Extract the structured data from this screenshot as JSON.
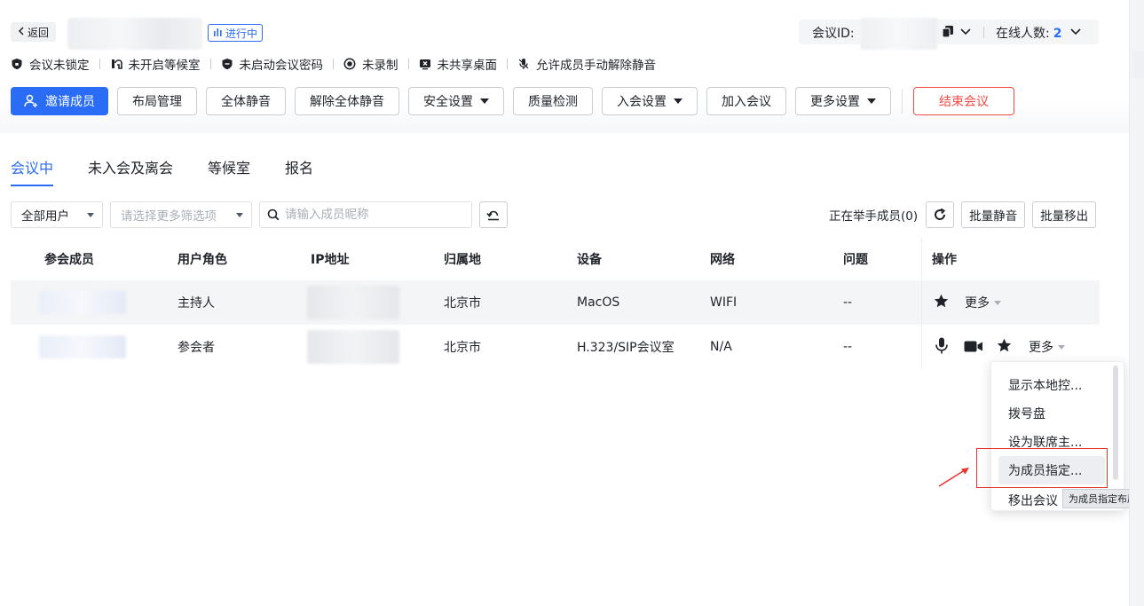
{
  "header": {
    "back_label": "返回",
    "status_tag": "进行中",
    "meeting_id_label": "会议ID:",
    "online_label": "在线人数:",
    "online_count": "2"
  },
  "status_items": [
    {
      "icon": "shield-icon",
      "label": "会议未锁定"
    },
    {
      "icon": "waiting-room-icon",
      "label": "未开启等候室"
    },
    {
      "icon": "shield-lock-icon",
      "label": "未启动会议密码"
    },
    {
      "icon": "record-icon",
      "label": "未录制"
    },
    {
      "icon": "screen-share-icon",
      "label": "未共享桌面"
    },
    {
      "icon": "microphone-icon",
      "label": "允许成员手动解除静音"
    }
  ],
  "toolbar": {
    "invite": "邀请成员",
    "layout": "布局管理",
    "mute_all": "全体静音",
    "unmute_all": "解除全体静音",
    "security": "安全设置",
    "quality": "质量检测",
    "join_settings": "入会设置",
    "join_meeting": "加入会议",
    "more_settings": "更多设置",
    "end_meeting": "结束会议"
  },
  "tabs": [
    "会议中",
    "未入会及离会",
    "等候室",
    "报名"
  ],
  "filters": {
    "user_select": "全部用户",
    "more_filters_placeholder": "请选择更多筛选项",
    "search_placeholder": "请输入成员昵称"
  },
  "right_actions": {
    "hand_raised": "正在举手成员(0)",
    "batch_mute": "批量静音",
    "batch_remove": "批量移出"
  },
  "table": {
    "columns": [
      "参会成员",
      "用户角色",
      "IP地址",
      "归属地",
      "设备",
      "网络",
      "问题",
      "操作"
    ],
    "rows": [
      {
        "role": "主持人",
        "location": "北京市",
        "device": "MacOS",
        "network": "WIFI",
        "issue": "--",
        "more": "更多"
      },
      {
        "role": "参会者",
        "location": "北京市",
        "device": "H.323/SIP会议室",
        "network": "N/A",
        "issue": "--",
        "more": "更多"
      }
    ]
  },
  "menu": {
    "items": [
      "显示本地控...",
      "拨号盘",
      "设为联席主...",
      "为成员指定...",
      "移出会议"
    ],
    "tooltip": "为成员指定布局"
  },
  "colors": {
    "accent": "#2b6cf6",
    "danger": "#f54a45",
    "highlight_box": "#e8362e"
  }
}
